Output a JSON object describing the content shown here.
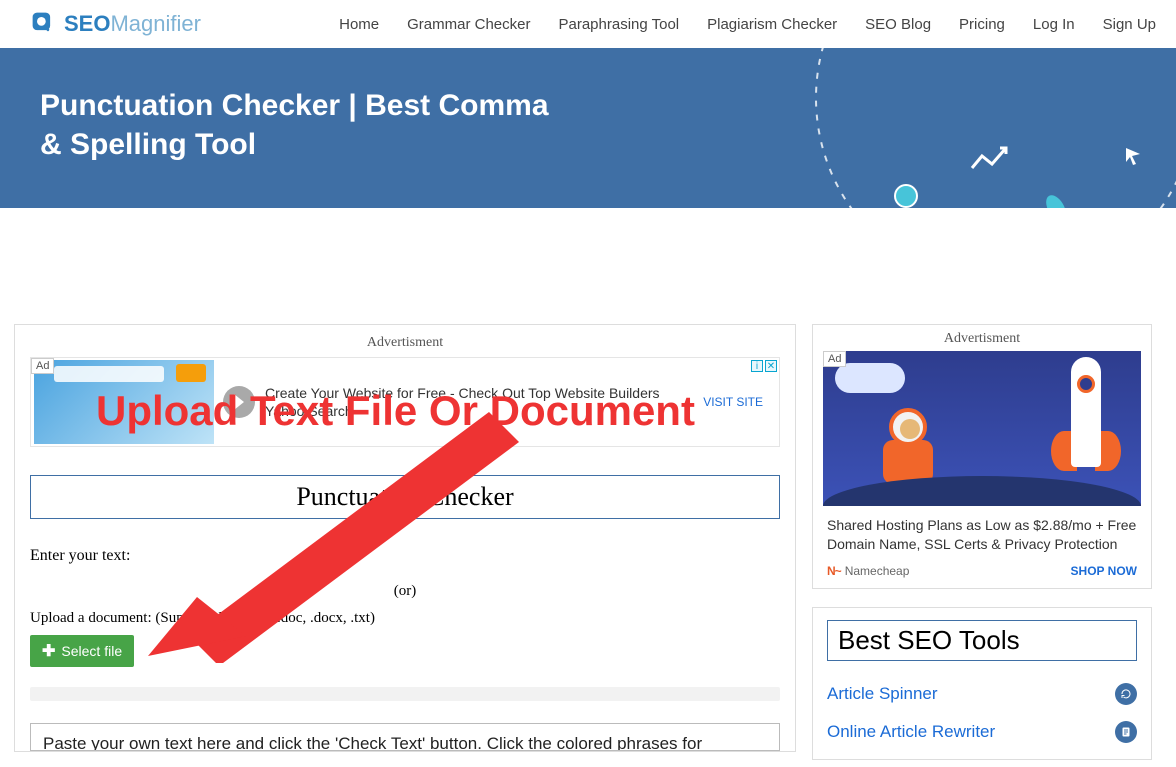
{
  "brand": {
    "seo": "SEO",
    "mag": "Magnifier"
  },
  "nav": {
    "home": "Home",
    "grammar": "Grammar Checker",
    "paraphrase": "Paraphrasing Tool",
    "plagiarism": "Plagiarism Checker",
    "blog": "SEO Blog",
    "pricing": "Pricing",
    "login": "Log In",
    "signup": "Sign Up"
  },
  "hero": {
    "title": "Punctuation Checker | Best Comma & Spelling Tool"
  },
  "ad": {
    "label": "Advertisment",
    "badge": "Ad",
    "headline": "Create Your Website for Free - Check Out Top Website Builders",
    "sub": "Yahoo Search",
    "visit": "VISIT SITE"
  },
  "tool": {
    "title": "Punctuation Checker",
    "enter_label": "Enter your text:",
    "or": "(or)",
    "upload_label": "Upload a document: (Supported Format: .doc, .docx, .txt)",
    "select_btn": "Select file",
    "paste_placeholder": "Paste your own text here and click the 'Check Text' button. Click the colored phrases for"
  },
  "side_ad": {
    "label": "Advertisment",
    "badge": "Ad",
    "text": "Shared Hosting Plans as Low as $2.88/mo + Free Domain Name, SSL Certs & Privacy Protection",
    "brand": "Namecheap",
    "cta": "SHOP NOW"
  },
  "seo_tools": {
    "title": "Best SEO Tools",
    "link1": "Article Spinner",
    "link2": "Online Article Rewriter"
  },
  "annotation": {
    "text": "Upload Text File Or Document"
  }
}
